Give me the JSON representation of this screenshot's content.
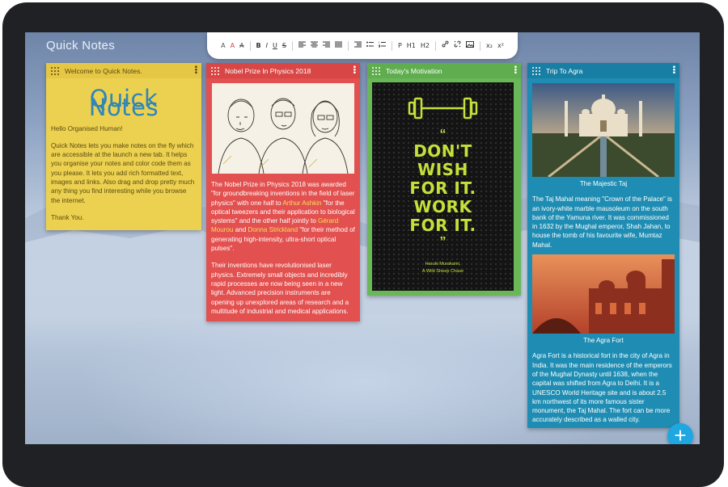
{
  "app": {
    "title": "Quick Notes"
  },
  "toolbar": {
    "groups": [
      [
        "A",
        "A",
        "A"
      ],
      [
        "B",
        "I",
        "U",
        "S"
      ],
      [
        "align-left-icon",
        "align-center-icon",
        "align-right-icon",
        "align-justify-icon"
      ],
      [
        "indent-icon",
        "bulleted-list-icon",
        "numbered-list-icon"
      ],
      [
        "P",
        "H1",
        "H2"
      ],
      [
        "link-icon",
        "unlink-icon",
        "image-icon"
      ],
      [
        "x₂",
        "x²"
      ]
    ]
  },
  "notes": {
    "welcome": {
      "header": "Welcome to Quick Notes.",
      "big_title": "Quick Notes",
      "p1": "Hello Organised Human!",
      "p2": "Quick Notes lets you make notes on the fly which are accessible at the launch a new tab. It helps you organise your notes and color code them as you please. It lets you add rich formatted text, images and links. Also drag and drop pretty much any thing you find interesting while you browse the internet.",
      "p3": "Thank You.",
      "color": "#ecd151"
    },
    "nobel": {
      "header": "Nobel Prize In Physics 2018",
      "p1_a": "The Nobel Prize in Physics 2018 was awarded \"for groundbreaking inventions in the field of laser physics\" with one half to ",
      "p1_link1": "Arthur Ashkin",
      "p1_b": " \"for the optical tweezers and their application to biological systems\" and the other half jointly to ",
      "p1_link2": "Gérard Mourou",
      "p1_c": " and ",
      "p1_link3": "Donna Strickland",
      "p1_d": " \"for their method of generating high-intensity, ultra-short optical pulses\".",
      "p2": "Their inventions have revolutionised laser physics. Extremely small objects and incredibly rapid processes are now being seen in a new light. Advanced precision instruments are opening up unexplored areas of research and a multitude of industrial and medical applications.",
      "color": "#e2504f",
      "link_color": "#f8de5e"
    },
    "motivation": {
      "header": "Today's Motivation",
      "quote_lines": [
        "DON'T",
        "WISH",
        "FOR IT.",
        "WORK",
        "FOR IT."
      ],
      "quote_open": "“",
      "quote_close": "”",
      "author_line1": "Haruki Murakami,",
      "author_line2": "A Wild Sheep Chase",
      "color": "#6ab758",
      "quote_color": "#c5e03a"
    },
    "agra": {
      "header": "Trip To Agra",
      "caption1": "The Majestic Taj",
      "p1": "The Taj Mahal meaning \"Crown of the Palace\" is an ivory-white marble mausoleum on the south bank of the Yamuna river. It was commissioned in 1632 by the Mughal emperor, Shah Jahan, to house the tomb of his favourite wife, Mumtaz Mahal.",
      "caption2": "The Agra Fort",
      "p2": "Agra Fort is a historical fort in the city of Agra in India. It was the main residence of the emperors of the Mughal Dynasty until 1638, when the capital was shifted from Agra to Delhi. It is a UNESCO World Heritage site and is about 2.5 km northwest of its more famous sister monument, the Taj Mahal. The fort can be more accurately described as a walled city.",
      "color": "#1f8db3"
    }
  },
  "fab": {
    "label": "+"
  }
}
